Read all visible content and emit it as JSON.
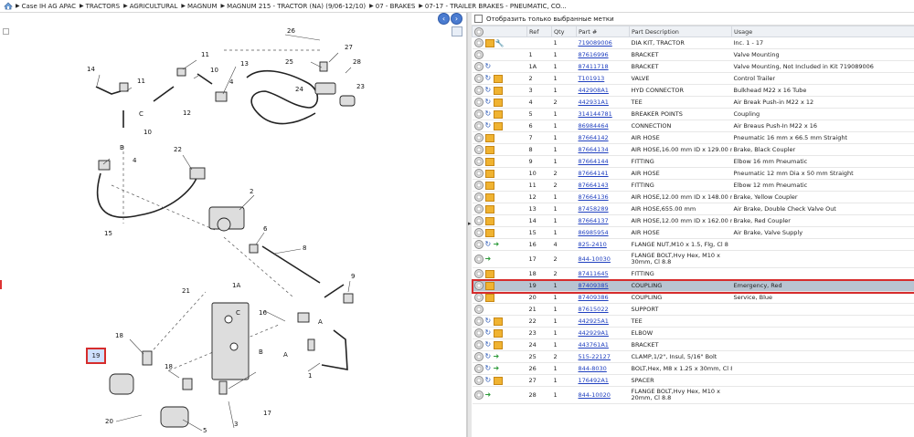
{
  "breadcrumb": [
    "Case IH AG APAC",
    "TRACTORS",
    "AGRICULTURAL",
    "MAGNUM",
    "MAGNUM 215 - TRACTOR (NA) (9/06-12/10)",
    "07 - BRAKES",
    "07-17 - TRAILER BRAKES - PNEUMATIC, CO..."
  ],
  "filter": {
    "label": "Отобразить только выбранные метки"
  },
  "table": {
    "headers": [
      "Ref",
      "Qty",
      "Part #",
      "Part Description",
      "Usage"
    ],
    "rows": [
      {
        "ref": "",
        "qty": "1",
        "part": "719089006",
        "desc": "DIA KIT, TRACTOR",
        "usage": "Inc. 1 - 17",
        "icons": [
          "gear",
          "box",
          "wrench"
        ]
      },
      {
        "ref": "1",
        "qty": "1",
        "part": "87616996",
        "desc": "BRACKET",
        "usage": "Valve Mounting",
        "icons": [
          "gear"
        ]
      },
      {
        "ref": "1A",
        "qty": "1",
        "part": "87411718",
        "desc": "BRACKET",
        "usage": "Valve Mounting, Not Included in Kit 719089006",
        "icons": [
          "gear",
          "info"
        ]
      },
      {
        "ref": "2",
        "qty": "1",
        "part": "T101913",
        "desc": "VALVE",
        "usage": "Control Trailer",
        "icons": [
          "gear",
          "info",
          "box"
        ]
      },
      {
        "ref": "3",
        "qty": "1",
        "part": "442908A1",
        "desc": "HYD CONNECTOR",
        "usage": "Bulkhead M22 x 16 Tube",
        "icons": [
          "gear",
          "info",
          "box"
        ]
      },
      {
        "ref": "4",
        "qty": "2",
        "part": "442931A1",
        "desc": "TEE",
        "usage": "Air Break Push-in M22 x 12",
        "icons": [
          "gear",
          "info",
          "box"
        ]
      },
      {
        "ref": "5",
        "qty": "1",
        "part": "314144781",
        "desc": "BREAKER POINTS",
        "usage": "Coupling",
        "icons": [
          "gear",
          "info",
          "box"
        ]
      },
      {
        "ref": "6",
        "qty": "1",
        "part": "86984464",
        "desc": "CONNECTION",
        "usage": "Air Breaus Push-In M22 x 16",
        "icons": [
          "gear",
          "info",
          "box"
        ]
      },
      {
        "ref": "7",
        "qty": "1",
        "part": "87664142",
        "desc": "AIR HOSE",
        "usage": "Pneumatic 16 mm x 66.5 mm Straight",
        "icons": [
          "gear",
          "box"
        ]
      },
      {
        "ref": "8",
        "qty": "1",
        "part": "87664134",
        "desc": "AIR HOSE,16.00 mm ID x 129.00 mm",
        "usage": "Brake, Black Coupler",
        "icons": [
          "gear",
          "box"
        ]
      },
      {
        "ref": "9",
        "qty": "1",
        "part": "87664144",
        "desc": "FITTING",
        "usage": "Elbow  16 mm Pneumatic",
        "icons": [
          "gear",
          "box"
        ]
      },
      {
        "ref": "10",
        "qty": "2",
        "part": "87664141",
        "desc": "AIR HOSE",
        "usage": "Pneumatic 12 mm Dia x 50 mm Straight",
        "icons": [
          "gear",
          "box"
        ]
      },
      {
        "ref": "11",
        "qty": "2",
        "part": "87664143",
        "desc": "FITTING",
        "usage": "Elbow 12 mm Pneumatic",
        "icons": [
          "gear",
          "box"
        ]
      },
      {
        "ref": "12",
        "qty": "1",
        "part": "87664136",
        "desc": "AIR HOSE,12.00 mm ID x 148.00 mm",
        "usage": "Brake, Yellow Coupler",
        "icons": [
          "gear",
          "box"
        ]
      },
      {
        "ref": "13",
        "qty": "1",
        "part": "87458289",
        "desc": "AIR HOSE,655.00 mm",
        "usage": "Air Brake, Double Check Valve Out",
        "icons": [
          "gear",
          "box"
        ]
      },
      {
        "ref": "14",
        "qty": "1",
        "part": "87664137",
        "desc": "AIR HOSE,12.00 mm ID x 162.00 mm",
        "usage": "Brake, Red Coupler",
        "icons": [
          "gear",
          "box"
        ]
      },
      {
        "ref": "15",
        "qty": "1",
        "part": "86985954",
        "desc": "AIR HOSE",
        "usage": "Air Brake, Valve Supply",
        "icons": [
          "gear",
          "box"
        ]
      },
      {
        "ref": "16",
        "qty": "4",
        "part": "825-2410",
        "desc": "FLANGE NUT,M10 x 1.5, Flg, Cl 8",
        "usage": "",
        "icons": [
          "gear",
          "info",
          "arrow"
        ]
      },
      {
        "ref": "17",
        "qty": "2",
        "part": "844-10030",
        "desc": "FLANGE BOLT,Hvy Hex, M10 x 30mm, Cl 8.8",
        "usage": "",
        "icons": [
          "gear",
          "arrow"
        ],
        "tall": true
      },
      {
        "ref": "18",
        "qty": "2",
        "part": "87411645",
        "desc": "FITTING",
        "usage": "",
        "icons": [
          "gear",
          "box"
        ]
      },
      {
        "ref": "19",
        "qty": "1",
        "part": "87409385",
        "desc": "COUPLING",
        "usage": "Emergency, Red",
        "icons": [
          "gear",
          "box"
        ],
        "selected": true
      },
      {
        "ref": "20",
        "qty": "1",
        "part": "87409386",
        "desc": "COUPLING",
        "usage": "Service, Blue",
        "icons": [
          "gear",
          "box"
        ]
      },
      {
        "ref": "21",
        "qty": "1",
        "part": "87615022",
        "desc": "SUPPORT",
        "usage": "",
        "icons": [
          "gear"
        ]
      },
      {
        "ref": "22",
        "qty": "1",
        "part": "442925A1",
        "desc": "TEE",
        "usage": "",
        "icons": [
          "gear",
          "info",
          "box"
        ]
      },
      {
        "ref": "23",
        "qty": "1",
        "part": "442929A1",
        "desc": "ELBOW",
        "usage": "",
        "icons": [
          "gear",
          "info",
          "box"
        ]
      },
      {
        "ref": "24",
        "qty": "1",
        "part": "443761A1",
        "desc": "BRACKET",
        "usage": "",
        "icons": [
          "gear",
          "info",
          "box"
        ]
      },
      {
        "ref": "25",
        "qty": "2",
        "part": "515-22127",
        "desc": "CLAMP,1/2\", Insul, 5/16\" Bolt",
        "usage": "",
        "icons": [
          "gear",
          "info",
          "arrow"
        ]
      },
      {
        "ref": "26",
        "qty": "1",
        "part": "844-8030",
        "desc": "BOLT,Hex, M8 x 1.25 x 30mm, Cl 8.8",
        "usage": "",
        "icons": [
          "gear",
          "info",
          "arrow"
        ]
      },
      {
        "ref": "27",
        "qty": "1",
        "part": "176492A1",
        "desc": "SPACER",
        "usage": "",
        "icons": [
          "gear",
          "info",
          "box"
        ]
      },
      {
        "ref": "28",
        "qty": "1",
        "part": "844-10020",
        "desc": "FLANGE BOLT,Hvy Hex, M10 x 20mm, Cl 8.8",
        "usage": "",
        "icons": [
          "gear",
          "arrow"
        ],
        "tall": true
      }
    ]
  },
  "diagram": {
    "labels": [
      "26",
      "27",
      "25",
      "28",
      "24",
      "23",
      "13",
      "11",
      "10",
      "4",
      "14",
      "11",
      "C",
      "12",
      "10",
      "B",
      "4",
      "22",
      "2",
      "15",
      "6",
      "8",
      "1A",
      "9",
      "21",
      "C",
      "16",
      "A",
      "18",
      "19",
      "18",
      "17",
      "B",
      "A",
      "1",
      "20",
      "5",
      "3"
    ],
    "highlight": "19"
  }
}
